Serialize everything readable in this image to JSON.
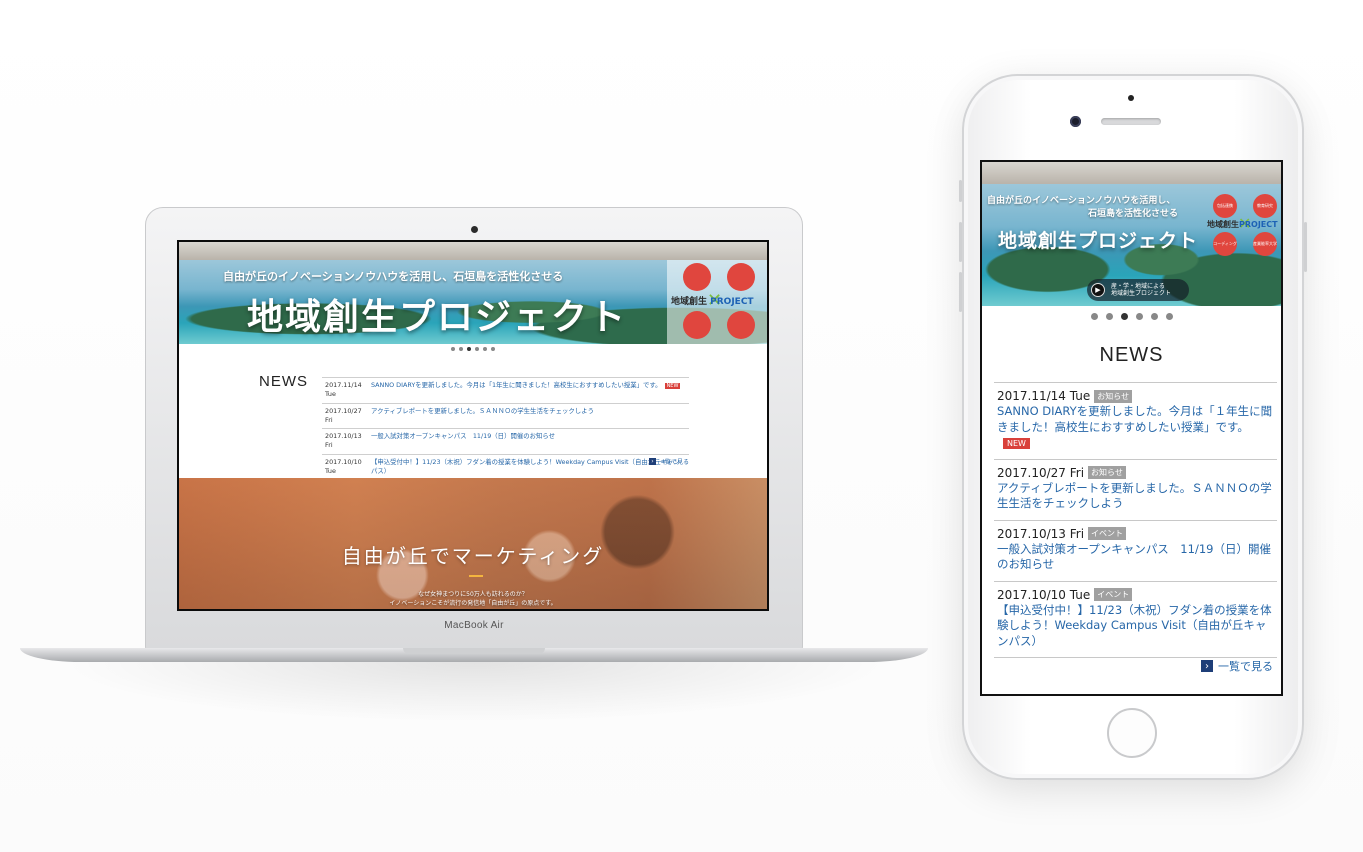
{
  "laptop": {
    "model": "MacBook Air",
    "hero": {
      "subtitle": "自由が丘のイノベーションノウハウを活用し、石垣島を活性化させる",
      "title": "地域創生プロジェクト",
      "logo_circles": [
        "",
        "",
        "",
        ""
      ],
      "logo_label": "地域創生",
      "logo_project": "PROJECT",
      "slides": 6,
      "active_slide": 3
    },
    "news": {
      "title": "NEWS",
      "items": [
        {
          "date": "2017.11/14 Tue",
          "tag": "",
          "text": "SANNO DIARYを更新しました。今月は「1年生に聞きました！高校生におすすめしたい授業」です。",
          "badge": "NEW"
        },
        {
          "date": "2017.10/27 Fri",
          "tag": "",
          "text": "アクティブレポートを更新しました。ＳＡＮＮＯの学生生活をチェックしよう",
          "badge": ""
        },
        {
          "date": "2017.10/13 Fri",
          "tag": "",
          "text": "一般入試対策オープンキャンパス　11/19（日）開催のお知らせ",
          "badge": ""
        },
        {
          "date": "2017.10/10 Tue",
          "tag": "",
          "text": "【申込受付中！】11/23（木祝）フダン着の授業を体験しよう！Weekday Campus Visit（自由が丘キャンパス）",
          "badge": ""
        }
      ],
      "more": "一覧で見る"
    },
    "marketing": {
      "title": "自由が丘でマーケティング",
      "line1": "なぜ女神まつりに50万人も訪れるのか？",
      "line2": "イノベーションこそが流行の発信地「自由が丘」の原点です。"
    }
  },
  "phone": {
    "hero": {
      "subtitle_line1": "自由が丘のイノベーションノウハウを活用し、",
      "subtitle_line2": "石垣島を活性化させる",
      "title": "地域創生プロジェクト",
      "video_label_line1": "産・学・地域による",
      "video_label_line2": "地域創生プロジェクト",
      "logo_circles": [
        "包括連携",
        "教育研究",
        "コーディング",
        "産業能率大学"
      ],
      "logo_label": "地域創生",
      "logo_project": "PROJECT",
      "slides": 6,
      "active_slide": 3
    },
    "news": {
      "title": "NEWS",
      "items": [
        {
          "date": "2017.11/14 Tue",
          "tag": "お知らせ",
          "text": "SANNO DIARYを更新しました。今月は「１年生に聞きました！高校生におすすめしたい授業」です。",
          "badge": "NEW"
        },
        {
          "date": "2017.10/27 Fri",
          "tag": "お知らせ",
          "text": "アクティブレポートを更新しました。ＳＡＮＮＯの学生生活をチェックしよう",
          "badge": ""
        },
        {
          "date": "2017.10/13 Fri",
          "tag": "イベント",
          "text": "一般入試対策オープンキャンパス　11/19（日）開催のお知らせ",
          "badge": ""
        },
        {
          "date": "2017.10/10 Tue",
          "tag": "イベント",
          "text": "【申込受付中！】11/23（木祝）フダン着の授業を体験しよう！Weekday Campus Visit（自由が丘キャンパス）",
          "badge": ""
        }
      ],
      "more": "一覧で見る"
    }
  },
  "colors": {
    "link": "#2767a8",
    "new_badge": "#d9403a",
    "tag": "#9a9a9a",
    "more_icon": "#1e3e78",
    "logo_circle": "#e0463e"
  },
  "icons": {
    "more": "chevron-right-icon",
    "play": "play-icon"
  }
}
